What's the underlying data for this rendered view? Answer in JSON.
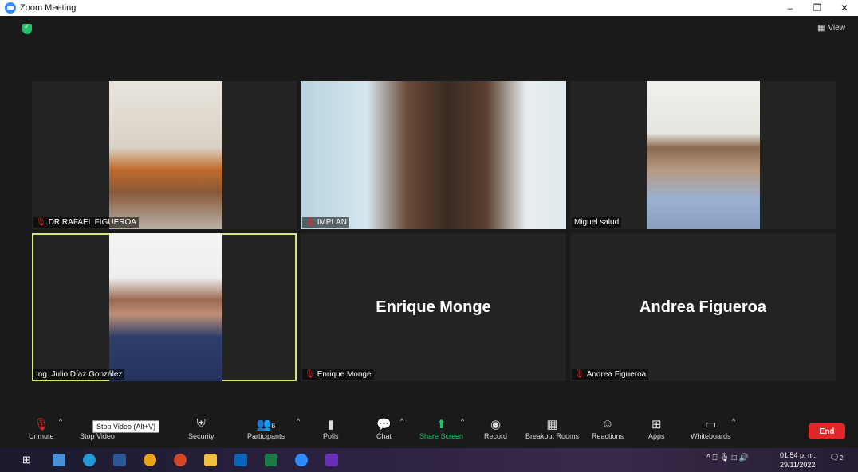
{
  "window": {
    "title": "Zoom Meeting",
    "minimize": "–",
    "restore": "❐",
    "close": "✕"
  },
  "view_button": {
    "label": "View"
  },
  "participants": [
    {
      "name": "DR RAFAEL FIGUEROA",
      "muted": true
    },
    {
      "name": "IMPLAN",
      "muted": true
    },
    {
      "name": "Miguel salud",
      "muted": false
    },
    {
      "name": "Ing. Julio Díaz González",
      "muted": false
    },
    {
      "name": "Enrique Monge",
      "muted": true,
      "display_name": "Enrique Monge"
    },
    {
      "name": "Andrea Figueroa",
      "muted": true,
      "display_name": "Andrea Figueroa"
    }
  ],
  "toolbar": {
    "unmute": "Unmute",
    "stop_video": "Stop Video",
    "tooltip": "Stop Video (Alt+V)",
    "security": "Security",
    "participants": "Participants",
    "participants_count": "6",
    "polls": "Polls",
    "chat": "Chat",
    "share_screen": "Share Screen",
    "record": "Record",
    "breakout_rooms": "Breakout Rooms",
    "reactions": "Reactions",
    "apps": "Apps",
    "whiteboards": "Whiteboards",
    "end": "End"
  },
  "taskbar": {
    "time": "01:54 p. m.",
    "date": "29/11/2022",
    "notifications": "2"
  },
  "colors": {
    "end": "#e02828",
    "share": "#23c16b",
    "active_speaker": "#d8e57a",
    "zoom_blue": "#2d8cff"
  }
}
